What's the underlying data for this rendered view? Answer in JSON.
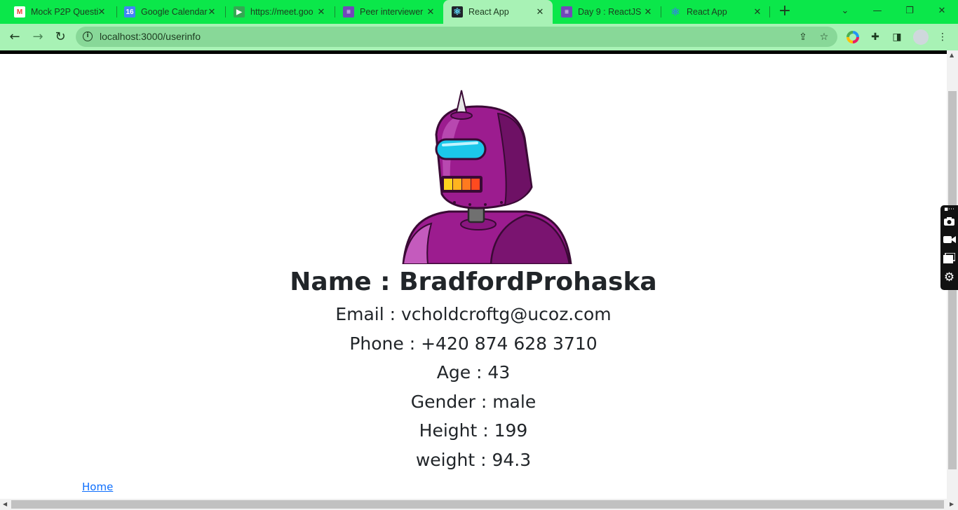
{
  "browser": {
    "tabs": [
      {
        "title": "Mock P2P Questi",
        "icon": "gmail-icon",
        "color": "#ea4335",
        "glyph": "M"
      },
      {
        "title": "Google Calendar",
        "icon": "calendar-icon",
        "color": "#4285f4",
        "glyph": "16"
      },
      {
        "title": "https://meet.goo",
        "icon": "meet-icon",
        "color": "#34a853",
        "glyph": "▶"
      },
      {
        "title": "Peer interviewer",
        "icon": "forms-icon",
        "color": "#7248b9",
        "glyph": "≡"
      },
      {
        "title": "React App",
        "icon": "react-icon",
        "color": "#61dafb",
        "glyph": "⚛",
        "active": true
      },
      {
        "title": "Day 9 : ReactJS",
        "icon": "forms-icon",
        "color": "#7248b9",
        "glyph": "≡"
      },
      {
        "title": "React App",
        "icon": "react-icon",
        "color": "#61dafb",
        "glyph": "⚛"
      }
    ],
    "url": "localhost:3000/userinfo",
    "accent_color": "#0be74a"
  },
  "user": {
    "name_line": "Name : BradfordProhaska",
    "email_line": "Email : vcholdcroftg@ucoz.com",
    "phone_line": "Phone : +420 874 628 3710",
    "age_line": "Age : 43",
    "gender_line": "Gender : male",
    "height_line": "Height : 199",
    "weight_line": "weight : 94.3"
  },
  "nav": {
    "home_link": "Home"
  }
}
